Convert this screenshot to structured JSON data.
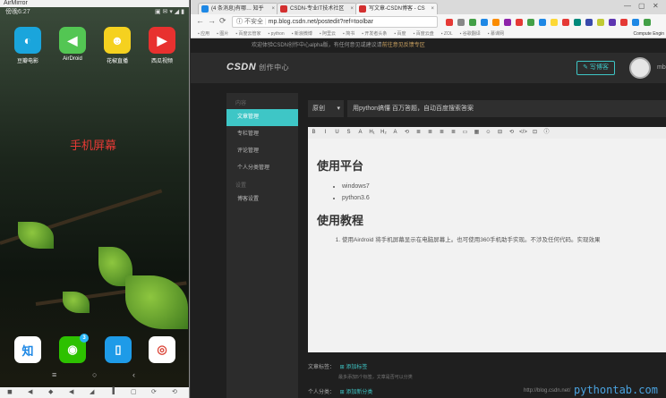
{
  "phone": {
    "app_title": "AirMirror",
    "status_time": "傍晚6:27",
    "status_right": "▣ ✉ ▾ ◢ ▮",
    "apps": [
      {
        "label": "豆瓣电影",
        "icon": "douban-movie-icon",
        "color": "#1aa5dc",
        "glyph": "◐"
      },
      {
        "label": "AirDroid",
        "icon": "airdroid-icon",
        "color": "#53c653",
        "glyph": "◀"
      },
      {
        "label": "花椒直播",
        "icon": "huajiao-live-icon",
        "color": "#f5d11f",
        "glyph": "☻"
      },
      {
        "label": "西瓜视频",
        "icon": "xigua-video-icon",
        "color": "#e8312f",
        "glyph": "▶"
      }
    ],
    "screen_label": "手机屏幕",
    "dock": [
      {
        "icon": "zhihu-icon",
        "color": "#ffffff",
        "glyph": "知",
        "text_color": "#1e88e5"
      },
      {
        "icon": "wechat-icon",
        "color": "#2dc100",
        "glyph": "◉",
        "text_color": "#ffffff",
        "badge": "3"
      },
      {
        "icon": "files-icon",
        "color": "#1e9be8",
        "glyph": "▯",
        "text_color": "#ffffff"
      },
      {
        "icon": "chrome-icon",
        "color": "#ffffff",
        "glyph": "◎",
        "text_color": "#db4437"
      }
    ],
    "nav": {
      "menu": "≡",
      "home": "○",
      "back": "‹"
    },
    "tools": [
      "◼",
      "◀",
      "◆",
      "◀",
      "◢",
      "▐",
      "▢",
      "⟳",
      "⟲"
    ]
  },
  "browser": {
    "tabs": [
      {
        "title": "(4 条消息)有哪… 知乎",
        "fav_color": "#1e88e5"
      },
      {
        "title": "CSDN-专业IT技术社区",
        "fav_color": "#d32f2f"
      },
      {
        "title": "写文章-CSDN博客 - CS",
        "fav_color": "#d32f2f"
      }
    ],
    "window_buttons": [
      "—",
      "▢",
      "✕"
    ],
    "address": {
      "security": "不安全",
      "url": "mp.blog.csdn.net/postedit?ref=toolbar"
    },
    "bookmarks": [
      "应用",
      "图片",
      "百度云管家",
      "python",
      "新浪微博",
      "阿里云",
      "简书",
      "开发者头条",
      "百度",
      "百度云盘",
      "ZOL",
      "谷歌翻译",
      "慕课网"
    ],
    "bookmarks_last": "Compute Engin",
    "ext_colors": [
      "#e53935",
      "#888888",
      "#43a047",
      "#1e88e5",
      "#fb8c00",
      "#8e24aa",
      "#e53935",
      "#43a047",
      "#1e88e5",
      "#fdd835",
      "#e53935",
      "#00897b",
      "#3949ab",
      "#c0ca33",
      "#5e35b1",
      "#e53935",
      "#1e88e5",
      "#43a047",
      "#fb8c00",
      "#039be5"
    ]
  },
  "site": {
    "notice": "欢迎体验CSDN创作中心alpha版，有任何意见或建议请",
    "notice_link": "前往意见反馈专区",
    "logo": "CSDN",
    "logo_sub": "创作中心",
    "write_btn": "✎ 写博客",
    "user": "mb",
    "sidebar": {
      "group1": "内容",
      "items1": [
        "文章管理",
        "专栏管理",
        "评论管理",
        "个人分类管理"
      ],
      "group2": "设置",
      "items2": [
        "博客设置"
      ]
    },
    "editor": {
      "category": "原创",
      "title": "用python搞懂 百万答题，自动百度搜索答案",
      "toolbar": [
        "B",
        "I",
        "U",
        "S",
        "A",
        "H₁",
        "H₂",
        "A",
        "⟲",
        "≣",
        "≣",
        "≣",
        "≣",
        "▭",
        "▦",
        "☺",
        "⊟",
        "⟲",
        "</>",
        "⊡",
        "ⓘ"
      ],
      "h1": "使用平台",
      "list": [
        "windows7",
        "python3.6"
      ],
      "h2": "使用教程",
      "ol": [
        "使用Airdroid 将手机屏幕显示在电脑屏幕上。也可使用360手机助手实现。不涉及任何代码。实现效果"
      ]
    },
    "meta": {
      "tags_label": "文章标签：",
      "tags_add": "添加标签",
      "tags_hint": "最多添加5个标签，文章是否可以分类",
      "cat_label": "个人分类：",
      "cat_add": "添加新分类"
    },
    "watermark": "pythontab.com",
    "watermark_small": "http://blog.csdn.net/"
  }
}
